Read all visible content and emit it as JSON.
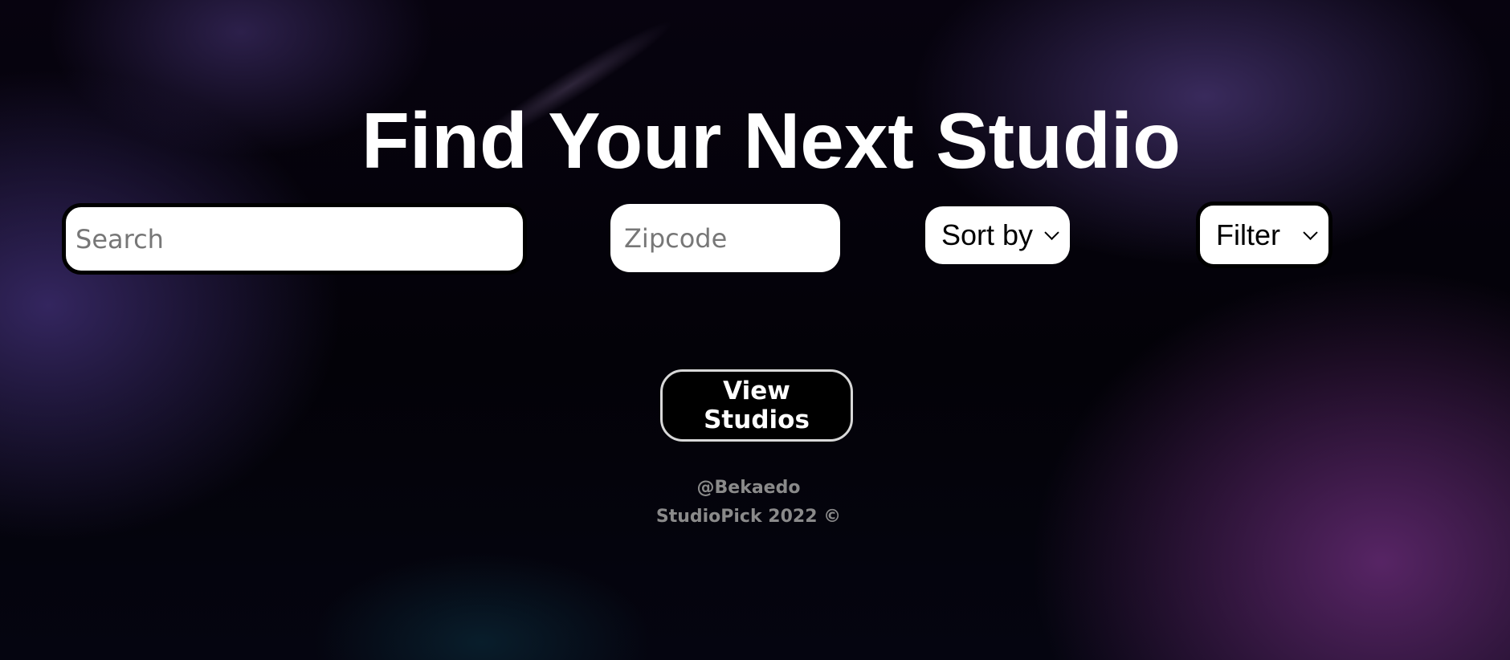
{
  "hero": {
    "title": "Find Your Next Studio"
  },
  "search_bar": {
    "search_placeholder": "Search",
    "zipcode_placeholder": "Zipcode",
    "sort_label": "Sort by",
    "filter_label": "Filter"
  },
  "cta": {
    "view_studios_label": "View Studios"
  },
  "footer": {
    "handle": "@Bekaedo",
    "copyright": "StudioPick 2022 ©"
  },
  "colors": {
    "title_text": "#ffffff",
    "button_background": "#000000",
    "button_border": "#d8d8d8",
    "footer_text": "#8a8a8a"
  },
  "icons": {
    "select_chevron": "chevron-down-icon"
  }
}
